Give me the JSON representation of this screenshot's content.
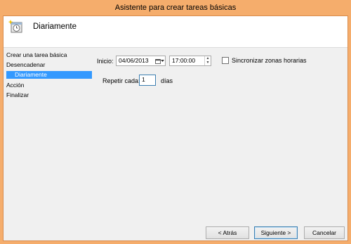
{
  "window": {
    "title": "Asistente para crear tareas básicas"
  },
  "header": {
    "title": "Diariamente",
    "icon": "task-scheduler-icon"
  },
  "nav": {
    "items": [
      {
        "label": "Crear una tarea básica"
      },
      {
        "label": "Desencadenar"
      },
      {
        "label": "Diariamente",
        "selected": true
      },
      {
        "label": "Acción"
      },
      {
        "label": "Finalizar"
      }
    ]
  },
  "form": {
    "start_label": "Inicio:",
    "start_date": "04/06/2013",
    "start_time": "17:00:00",
    "sync_timezones_label": "Sincronizar zonas horarias",
    "sync_timezones_checked": false,
    "repeat_label": "Repetir cada:",
    "repeat_value": "1",
    "repeat_unit": "días"
  },
  "footer": {
    "back_label": "< Atrás",
    "next_label": "Siguiente >",
    "cancel_label": "Cancelar"
  },
  "colors": {
    "title_bar": "#f5ad6c",
    "selection": "#3399ff",
    "focus_border": "#3c7fb1"
  }
}
